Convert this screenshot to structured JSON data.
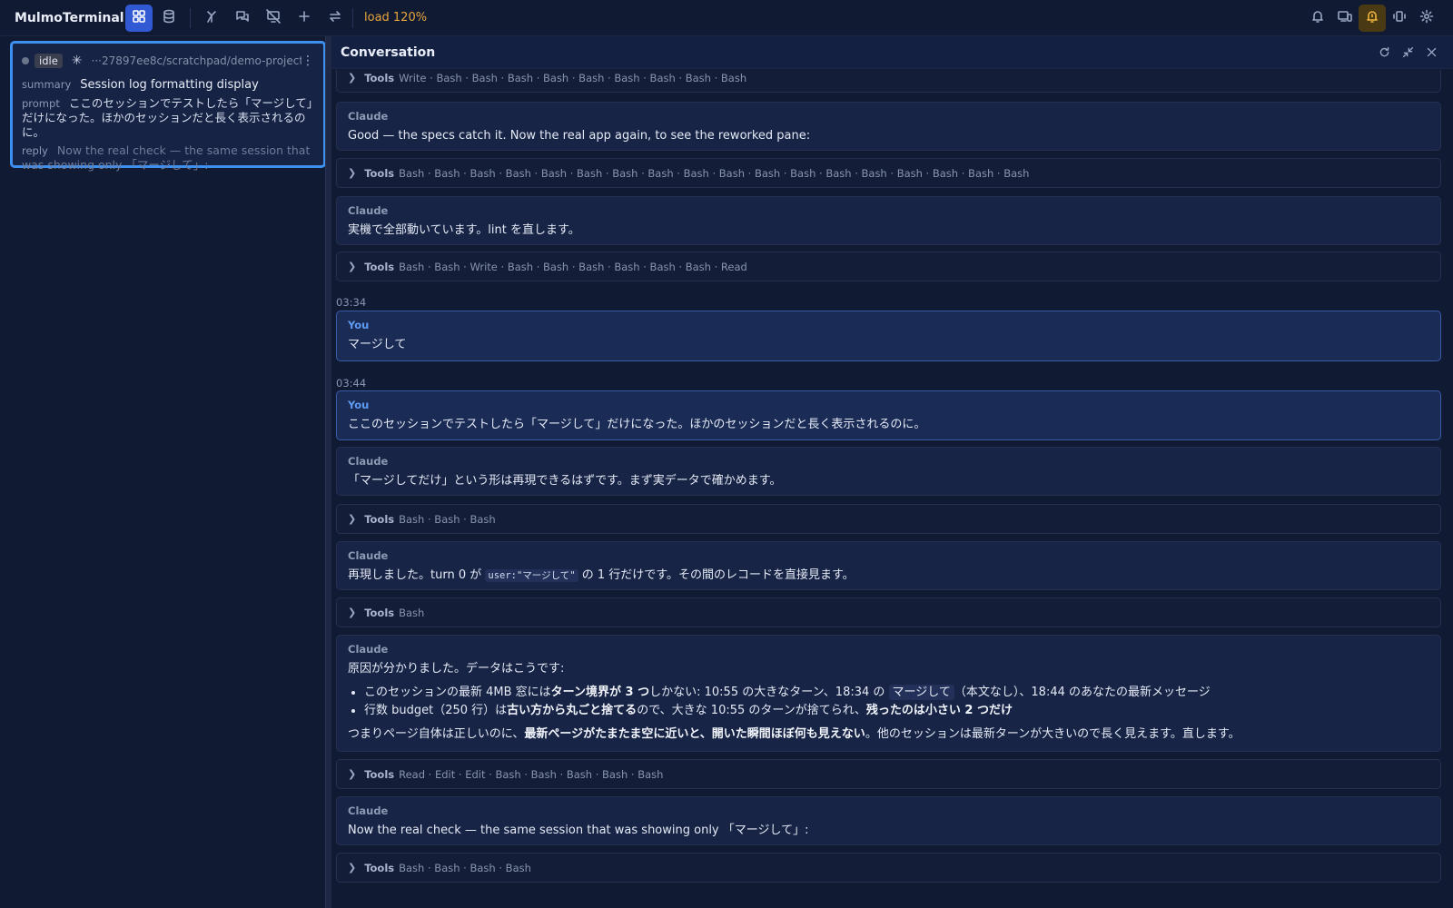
{
  "app": {
    "title": "MulmoTerminal",
    "load": "load 120%"
  },
  "session": {
    "status": "idle",
    "path": "···27897ee8c/scratchpad/demo-project",
    "summary_label": "summary",
    "summary": "Session log formatting display",
    "prompt_label": "prompt",
    "prompt": "ここのセッションでテストしたら「マージして」だけになった。ほかのセッションだと長く表示されるのに。",
    "reply_label": "reply",
    "reply": "Now the real check — the same session that was showing only 「マージして」:"
  },
  "conversation": {
    "title": "Conversation",
    "tools_label": "Tools",
    "claude": "Claude",
    "you": "You",
    "tools1": "Write · Bash · Bash · Bash · Bash · Bash · Bash · Bash · Bash · Bash",
    "m1": "Good — the specs catch it. Now the real app again, to see the reworked pane:",
    "tools2": "Bash · Bash · Bash · Bash · Bash · Bash · Bash · Bash · Bash · Bash · Bash · Bash · Bash · Bash · Bash · Bash · Bash · Bash",
    "m2": "実機で全部動いています。lint を直します。",
    "tools3": "Bash · Bash · Write · Bash · Bash · Bash · Bash · Bash · Bash · Read",
    "time1": "03:34",
    "y1": "マージして",
    "time2": "03:44",
    "y2": "ここのセッションでテストしたら「マージして」だけになった。ほかのセッションだと長く表示されるのに。",
    "m3": "「マージしてだけ」という形は再現できるはずです。まず実データで確かめます。",
    "tools4": "Bash · Bash · Bash",
    "m4_a": "再現しました。turn 0 が ",
    "m4_code": "user:\"マージして\"",
    "m4_b": " の 1 行だけです。その間のレコードを直接見ます。",
    "tools5": "Bash",
    "m5_intro": "原因が分かりました。データはこうです:",
    "m5_b1_a": "このセッションの最新 4MB 窓には",
    "m5_b1_bold": "ターン境界が 3 つ",
    "m5_b1_b": "しかない: 10:55 の大きなターン、18:34 の ",
    "m5_b1_code": "マージして",
    "m5_b1_c": "（本文なし）、18:44 のあなたの最新メッセージ",
    "m5_b2_a": "行数 budget（250 行）は",
    "m5_b2_bold1": "古い方から丸ごと捨てる",
    "m5_b2_b": "ので、大きな 10:55 のターンが捨てられ、",
    "m5_b2_bold2": "残ったのは小さい 2 つだけ",
    "m5_end_a": "つまりページ自体は正しいのに、",
    "m5_end_bold": "最新ページがたまたま空に近いと、開いた瞬間ほぼ何も見えない",
    "m5_end_b": "。他のセッションは最新ターンが大きいので長く見えます。直します。",
    "tools6": "Read · Edit · Edit · Bash · Bash · Bash · Bash · Bash",
    "m6": "Now the real check — the same session that was showing only 「マージして」:",
    "tools7": "Bash · Bash · Bash · Bash"
  }
}
